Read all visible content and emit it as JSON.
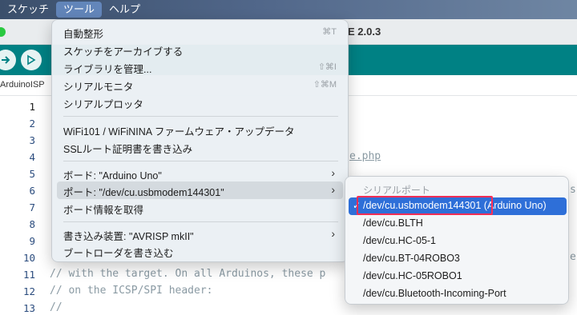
{
  "menubar": {
    "items": [
      "スケッチ",
      "ツール",
      "ヘルプ"
    ]
  },
  "window": {
    "title": "E 2.0.3"
  },
  "tab": {
    "name": "ArduinoISP"
  },
  "editor": {
    "line_numbers": [
      "1",
      "2",
      "3",
      "4",
      "5",
      "6",
      "7",
      "8",
      "9",
      "10",
      "11",
      "12",
      "13"
    ],
    "visible_fragments": {
      "line4_tail": "e.php",
      "line6_tail": "s",
      "line10_tail": "e",
      "line11": "// with the target. On all Arduinos, these p",
      "line12": "// on the ICSP/SPI header:",
      "line13": "//"
    }
  },
  "tools_menu": {
    "items": [
      {
        "label": "自動整形",
        "shortcut": "⌘T"
      },
      {
        "label": "スケッチをアーカイブする",
        "shortcut": ""
      },
      {
        "label": "ライブラリを管理...",
        "shortcut": "⇧⌘I"
      },
      {
        "label": "シリアルモニタ",
        "shortcut": "⇧⌘M"
      },
      {
        "label": "シリアルプロッタ",
        "shortcut": ""
      },
      {
        "label": "WiFi101 /  WiFiNINA ファームウェア・アップデータ",
        "shortcut": ""
      },
      {
        "label": "SSLルート証明書を書き込み",
        "shortcut": ""
      },
      {
        "label": "ボード: \"Arduino Uno\"",
        "shortcut": "",
        "submenu": true
      },
      {
        "label": "ポート: \"/dev/cu.usbmodem144301\"",
        "shortcut": "",
        "submenu": true,
        "highlighted": true
      },
      {
        "label": "ボード情報を取得",
        "shortcut": ""
      },
      {
        "label": "書き込み装置: \"AVRISP mkII\"",
        "shortcut": "",
        "submenu": true
      },
      {
        "label": "ブートローダを書き込む",
        "shortcut": ""
      }
    ]
  },
  "port_menu": {
    "header": "シリアルポート",
    "items": [
      {
        "label": "/dev/cu.usbmodem144301 (Arduino Uno)",
        "selected": true
      },
      {
        "label": "/dev/cu.BLTH"
      },
      {
        "label": "/dev/cu.HC-05-1"
      },
      {
        "label": "/dev/cu.BT-04ROBO3"
      },
      {
        "label": "/dev/cu.HC-05ROBO1"
      },
      {
        "label": "/dev/cu.Bluetooth-Incoming-Port"
      }
    ],
    "check_glyph": "✓"
  },
  "colors": {
    "toolbar": "#008184",
    "selection": "#2e6fd8",
    "focus_box": "#ff2d55"
  }
}
